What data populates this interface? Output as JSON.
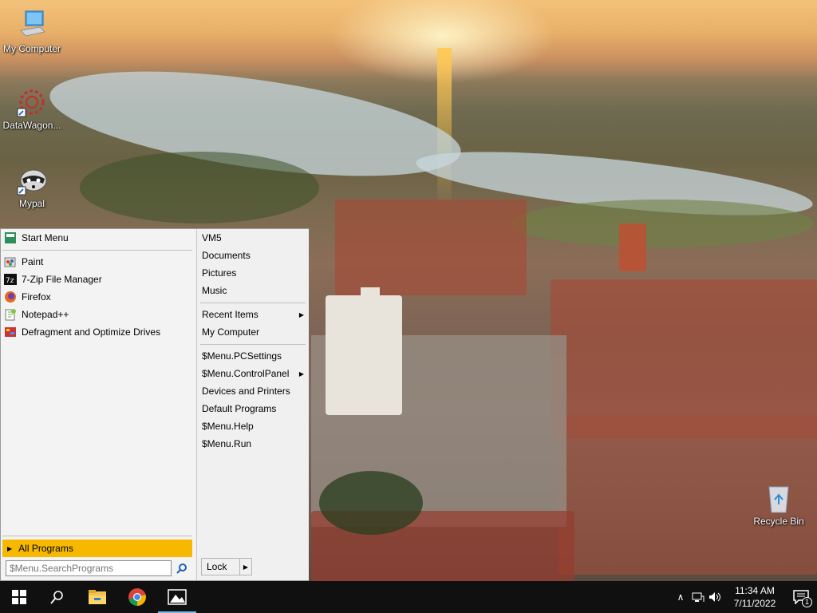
{
  "desktop": {
    "icons": [
      {
        "label": "My Computer"
      },
      {
        "label": "DataWagon..."
      },
      {
        "label": "Mypal"
      },
      {
        "label": "Recycle Bin"
      }
    ]
  },
  "start_menu": {
    "pinned": [
      {
        "label": "Start Menu",
        "icon": "start-menu-icon"
      },
      {
        "label": "Paint",
        "icon": "paint-icon"
      },
      {
        "label": "7-Zip File Manager",
        "icon": "7zip-icon"
      },
      {
        "label": "Firefox",
        "icon": "firefox-icon"
      },
      {
        "label": "Notepad++",
        "icon": "notepadpp-icon"
      },
      {
        "label": "Defragment and Optimize Drives",
        "icon": "defrag-icon"
      }
    ],
    "all_programs_label": "All Programs",
    "search_placeholder": "$Menu.SearchPrograms",
    "right": {
      "group1": [
        "VM5",
        "Documents",
        "Pictures",
        "Music"
      ],
      "group2": [
        "Recent Items",
        "My Computer"
      ],
      "group3": [
        "$Menu.PCSettings",
        "$Menu.ControlPanel",
        "Devices and Printers",
        "Default Programs",
        "$Menu.Help",
        "$Menu.Run"
      ]
    },
    "lock_label": "Lock"
  },
  "taskbar": {
    "buttons": [
      "start-button",
      "search-button",
      "file-explorer-button",
      "chrome-button",
      "photos-button"
    ],
    "clock_time": "11:34 AM",
    "clock_date": "7/11/2022",
    "notification_count": "1"
  },
  "colors": {
    "accent": "#f7b800",
    "taskbar": "#101010",
    "menu_bg": "#f0f0f0"
  }
}
